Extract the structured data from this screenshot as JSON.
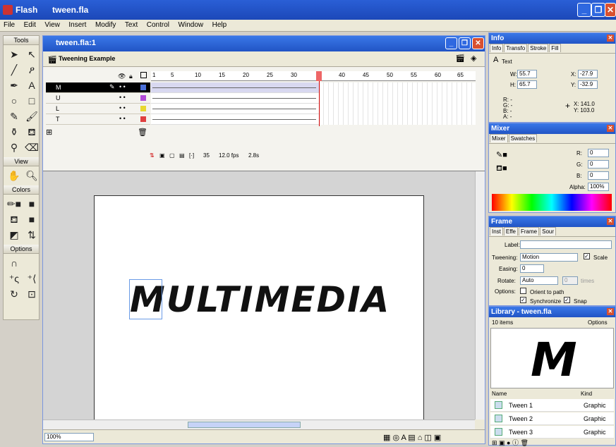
{
  "app": {
    "name": "Flash",
    "file": "tween.fla"
  },
  "menu": [
    "File",
    "Edit",
    "View",
    "Insert",
    "Modify",
    "Text",
    "Control",
    "Window",
    "Help"
  ],
  "tools": {
    "header": "Tools",
    "icons": [
      "arrow-tool-icon",
      "subselect-tool-icon",
      "line-tool-icon",
      "lasso-tool-icon",
      "pen-tool-icon",
      "text-tool-icon",
      "oval-tool-icon",
      "rect-tool-icon",
      "pencil-tool-icon",
      "brush-tool-icon",
      "ink-bottle-icon",
      "paint-bucket-icon",
      "eyedropper-icon",
      "eraser-icon"
    ],
    "view_label": "View",
    "colors_label": "Colors",
    "options_label": "Options"
  },
  "document": {
    "title": "tween.fla:1",
    "scene": "Tweening Example",
    "layers": [
      "M",
      "U",
      "L",
      "T"
    ],
    "ruler": [
      "1",
      "5",
      "10",
      "15",
      "20",
      "25",
      "30",
      "35",
      "40",
      "45",
      "50",
      "55",
      "60",
      "65"
    ],
    "current_frame": "35",
    "fps": "12.0 fps",
    "time": "2.8s",
    "stage_text": "MULTIMEDIA",
    "zoom": "100%"
  },
  "info_panel": {
    "title": "Info",
    "tabs": [
      "Info",
      "Transfo",
      "Stroke",
      "Fill"
    ],
    "object": "Text",
    "w": "55.7",
    "h": "65.7",
    "x": "-27.9",
    "y": "-32.9",
    "r": "R: -",
    "g": "G: -",
    "b": "B: -",
    "a": "A: -",
    "cx": "X: 141.0",
    "cy": "Y: 103.0"
  },
  "mixer_panel": {
    "title": "Mixer",
    "tabs": [
      "Mixer",
      "Swatches"
    ],
    "r_label": "R:",
    "r": "0",
    "g_label": "G:",
    "g": "0",
    "b_label": "B:",
    "b": "0",
    "alpha_label": "Alpha:",
    "alpha": "100%"
  },
  "frame_panel": {
    "title": "Frame",
    "tabs": [
      "Inst",
      "Effe",
      "Frame",
      "Sour"
    ],
    "label_label": "Label:",
    "tweening_label": "Tweening:",
    "tweening": "Motion",
    "scale_label": "Scale",
    "easing_label": "Easing:",
    "easing": "0",
    "rotate_label": "Rotate:",
    "rotate": "Auto",
    "times_label": "times",
    "options_label": "Options:",
    "orient": "Orient to path",
    "sync": "Synchronize",
    "snap": "Snap"
  },
  "library_panel": {
    "title": "Library - tween.fla",
    "count": "10 items",
    "options": "Options",
    "preview": "M",
    "col_name": "Name",
    "col_kind": "Kind",
    "items": [
      {
        "name": "Tween 1",
        "kind": "Graphic"
      },
      {
        "name": "Tween 2",
        "kind": "Graphic"
      },
      {
        "name": "Tween 3",
        "kind": "Graphic"
      }
    ]
  }
}
